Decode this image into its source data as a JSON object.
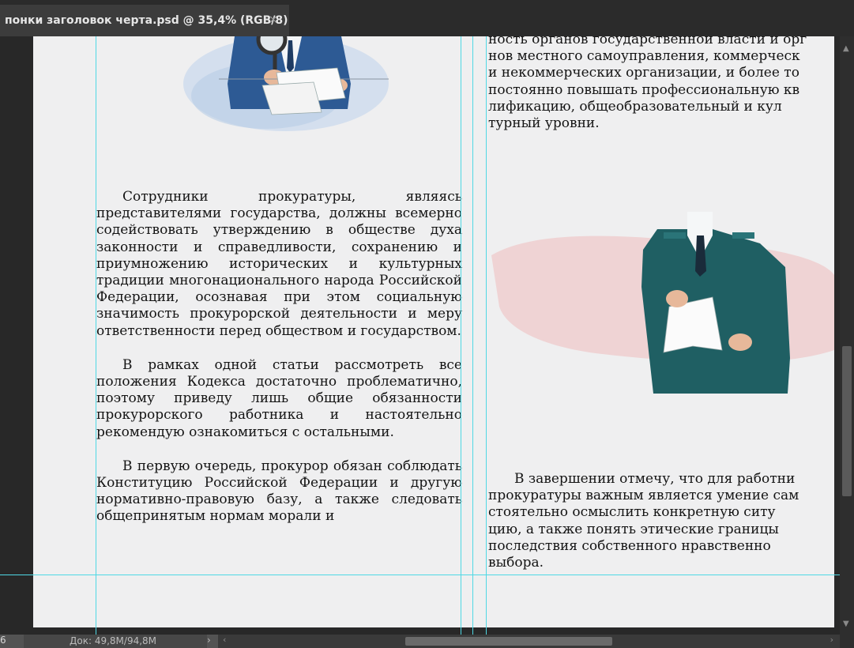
{
  "tab": {
    "title": "понки заголовок черта.psd @ 35,4% (RGB/8)",
    "close_label": "×"
  },
  "left_column": {
    "paragraphs": [
      "Сотрудники прокуратуры, являясь представителями государства, должны всемерно содействовать утверждению в обществе духа законности и справедливости, сохранению и приумножению исторических и культурных традиции многонационального народа Российской Федерации, осознавая при этом социальную значимость прокурорской деятельности и меру ответственности перед обществом и государством.",
      "В рамках одной статьи рассмотреть все положения Кодекса достаточно проблематично, поэтому приведу лишь общие обязанности прокурорского работника и настоятельно рекомендую ознакомиться с остальными.",
      "В первую очередь, прокурор обязан соблюдать Конституцию Российской Федерации и другую нормативно-правовую базу, а также следовать общепринятым нормам морали и"
    ]
  },
  "right_column": {
    "top_lines": [
      "ность органов государственной власти и орг",
      "нов местного самоуправления, коммерческ",
      "и некоммерческих организации, и более то",
      "постоянно повышать профессиональную кв",
      "лификацию, общеобразовательный и кул",
      "турный уровни."
    ],
    "bottom_lines": [
      "В завершении отмечу, что для работни",
      "прокуратуры важным является умение сам",
      "стоятельно осмыслить конкретную ситу",
      "цию, а также понять этические границы",
      "последствия собственного нравственно",
      "выбора."
    ]
  },
  "status": {
    "zoom_fragment": "6",
    "doc_size": "Док: 49,8M/94,8M",
    "arrow": "›"
  },
  "colors": {
    "guide": "#4fd8e4",
    "document_bg": "#efeff0",
    "workspace_bg": "#282828"
  },
  "icons": {
    "scroll_up": "▲",
    "scroll_down": "▼",
    "scroll_left": "‹",
    "scroll_right": "›"
  }
}
